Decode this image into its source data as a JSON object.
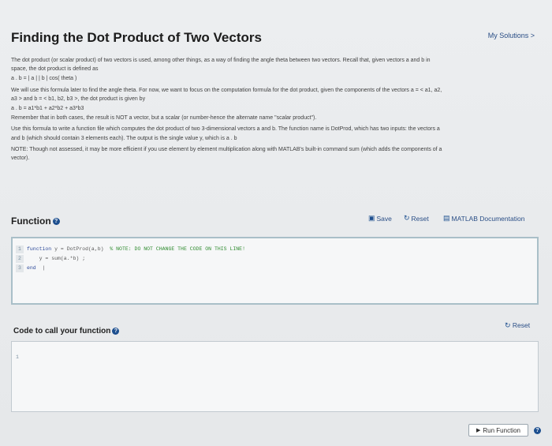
{
  "header": {
    "title": "Finding the Dot Product of Two Vectors",
    "my_solutions": "My Solutions >"
  },
  "description": {
    "p1": "The dot product (or scalar product) of two vectors is used, among other things, as a way of finding the angle theta between two vectors. Recall that, given vectors a and b in",
    "p1b": "space, the dot product is defined as",
    "formula1": "a . b = | a | | b | cos( theta )",
    "p2": "We will use this formula later to find the angle theta. For now, we want to focus on the computation formula for the dot product, given the components of the vectors a = < a1, a2,",
    "p2b": "a3 > and b = < b1, b2, b3 >, the dot product is given by",
    "formula2": "a . b = a1*b1 + a2*b2 + a3*b3",
    "p3": "Remember that in both cases, the result is NOT a vector, but a scalar (or number-hence the alternate name \"scalar product\").",
    "p4": "Use this formula to write a function file which computes the dot product of two 3-dimensional vectors a and b. The function name is DotProd, which has two inputs: the vectors a",
    "p4b": "and b (which should contain 3 elements each). The output is the single value y, which is a . b",
    "p5": "NOTE: Though not assessed, it may be more efficient if you use element by element multiplication along with MATLAB's built-in command sum (which adds the components of a",
    "p5b": "vector)."
  },
  "function_section": {
    "title": "Function",
    "save_label": "Save",
    "reset_label": "Reset",
    "doc_label": "MATLAB Documentation",
    "code": {
      "line1_num": "1",
      "line1_kw": "function",
      "line1_rest": " y = DotProd(a,b)  ",
      "line1_comment": "% NOTE: DO NOT CHANGE THE CODE ON THIS LINE!",
      "line2_num": "2",
      "line2": "    y = sum(a.*b) ;",
      "line3_num": "3",
      "line3_kw": "end",
      "line3_rest": "  |"
    }
  },
  "call_section": {
    "title": "Code to call your function",
    "reset_label": "Reset",
    "line_num": "1"
  },
  "run": {
    "label": "Run Function"
  },
  "icons": {
    "info": "info-icon",
    "save": "save-icon",
    "reset": "reset-icon",
    "doc": "documentation-icon",
    "run": "play-icon"
  },
  "colors": {
    "link": "#2a4e86",
    "info_icon": "#1d4f8f",
    "editor_border": "#a9bfc8"
  }
}
